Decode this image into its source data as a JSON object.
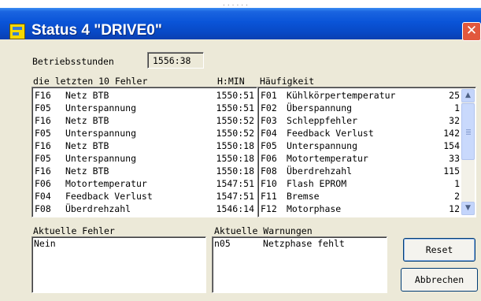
{
  "window": {
    "title": "Status 4 \"DRIVE0\"",
    "close_glyph": "✕",
    "top_strip": "......"
  },
  "hours": {
    "label": "Betriebsstunden",
    "value": "1556:38"
  },
  "faults": {
    "header": "die letzten 10 Fehler",
    "time_header": "H:MIN",
    "rows": [
      {
        "code": "F16",
        "text": "Netz BTB",
        "time": "1550:51"
      },
      {
        "code": "F05",
        "text": "Unterspannung",
        "time": "1550:51"
      },
      {
        "code": "F16",
        "text": "Netz BTB",
        "time": "1550:52"
      },
      {
        "code": "F05",
        "text": "Unterspannung",
        "time": "1550:52"
      },
      {
        "code": "F16",
        "text": "Netz BTB",
        "time": "1550:18"
      },
      {
        "code": "F05",
        "text": "Unterspannung",
        "time": "1550:18"
      },
      {
        "code": "F16",
        "text": "Netz BTB",
        "time": "1550:18"
      },
      {
        "code": "F06",
        "text": "Motortemperatur",
        "time": "1547:51"
      },
      {
        "code": "F04",
        "text": "Feedback Verlust",
        "time": "1547:51"
      },
      {
        "code": "F08",
        "text": "Überdrehzahl",
        "time": "1546:14"
      }
    ]
  },
  "frequency": {
    "header": "Häufigkeit",
    "rows": [
      {
        "code": "F01",
        "text": "Kühlkörpertemperatur",
        "count": "25"
      },
      {
        "code": "F02",
        "text": "Überspannung",
        "count": "1"
      },
      {
        "code": "F03",
        "text": "Schleppfehler",
        "count": "32"
      },
      {
        "code": "F04",
        "text": "Feedback Verlust",
        "count": "142"
      },
      {
        "code": "F05",
        "text": "Unterspannung",
        "count": "154"
      },
      {
        "code": "F06",
        "text": "Motortemperatur",
        "count": "33"
      },
      {
        "code": "F08",
        "text": "Überdrehzahl",
        "count": "115"
      },
      {
        "code": "F10",
        "text": "Flash EPROM",
        "count": "1"
      },
      {
        "code": "F11",
        "text": "Bremse",
        "count": "2"
      },
      {
        "code": "F12",
        "text": "Motorphase",
        "count": "12"
      }
    ]
  },
  "current_faults": {
    "label": "Aktuelle Fehler",
    "value": "Nein"
  },
  "current_warnings": {
    "label": "Aktuelle Warnungen",
    "code": "n05",
    "text": "Netzphase fehlt"
  },
  "buttons": {
    "reset": "Reset",
    "cancel": "Abbrechen"
  },
  "icons": {
    "window_icon": "app-window-icon",
    "close": "close-icon",
    "scroll_up": "scroll-up-icon",
    "scroll_down": "scroll-down-icon"
  },
  "colors": {
    "titlebar": "#0a54d8",
    "close": "#e2583d",
    "dialog_bg": "#ece9d8"
  }
}
